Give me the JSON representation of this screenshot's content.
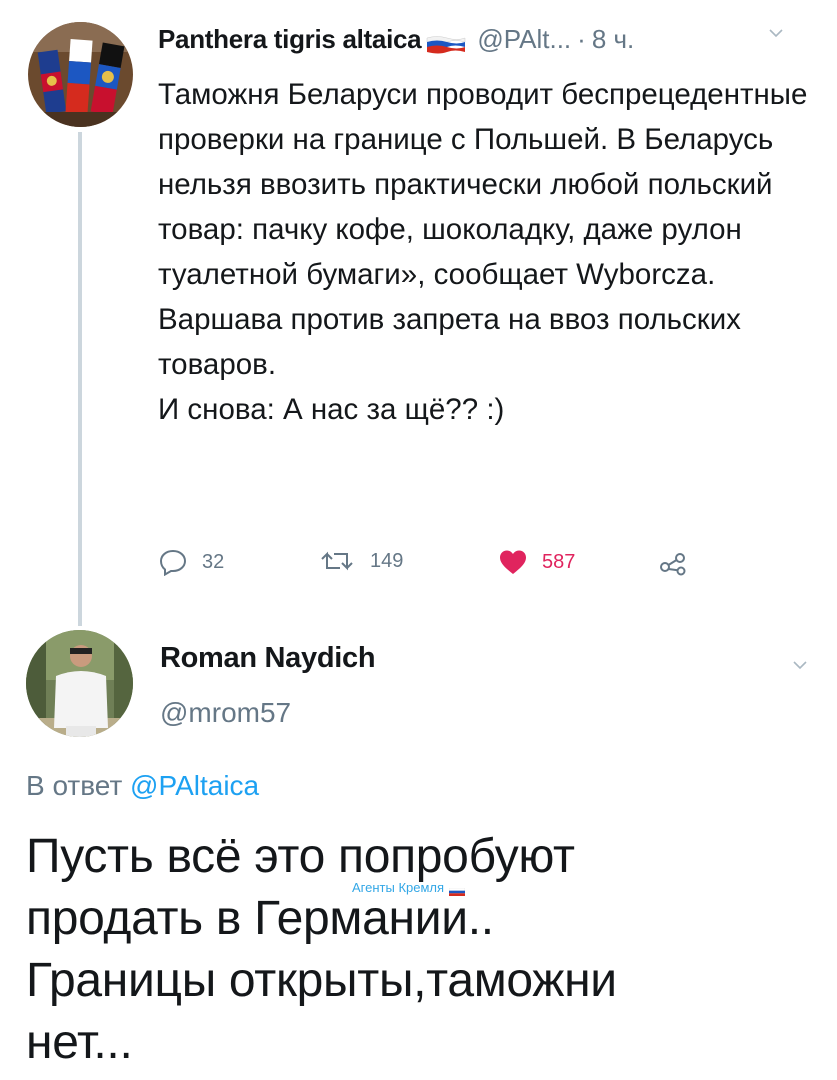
{
  "tweet1": {
    "author_name": "Panthera tigris altaica",
    "author_flag": "russia-flag-icon",
    "handle": "@PAlt...",
    "separator": "·",
    "time": "8 ч.",
    "body_lines": [
      "Таможня Беларуси проводит беспрецедентные проверки на границе с Польшей. В Беларусь нельзя ввозить практически любой польский товар: пачку кофе, шоколадку, даже рулон туалетной бумаги», сообщает Wyborcza.",
      "Варшава против запрета на ввоз польских товаров.",
      "И снова: А нас за щё?? :)"
    ],
    "actions": {
      "replies": "32",
      "retweets": "149",
      "likes": "587"
    },
    "like_color": "#e0245e"
  },
  "tweet2": {
    "author_name": "Roman Naydich",
    "handle": "@mrom57",
    "reply_prefix": "В ответ",
    "reply_mention": "@PAltaica",
    "body_lines": [
      "Пусть всё это попробуют",
      "продать в Германии..",
      "Границы открыты,таможни",
      "нет..."
    ]
  },
  "watermark": {
    "text": "Агенты Кремля",
    "flag": "russia-flag-icon"
  },
  "colors": {
    "text": "#14171a",
    "secondary": "#657786",
    "link": "#1da1f2",
    "thread_line": "#ccd6dd"
  }
}
